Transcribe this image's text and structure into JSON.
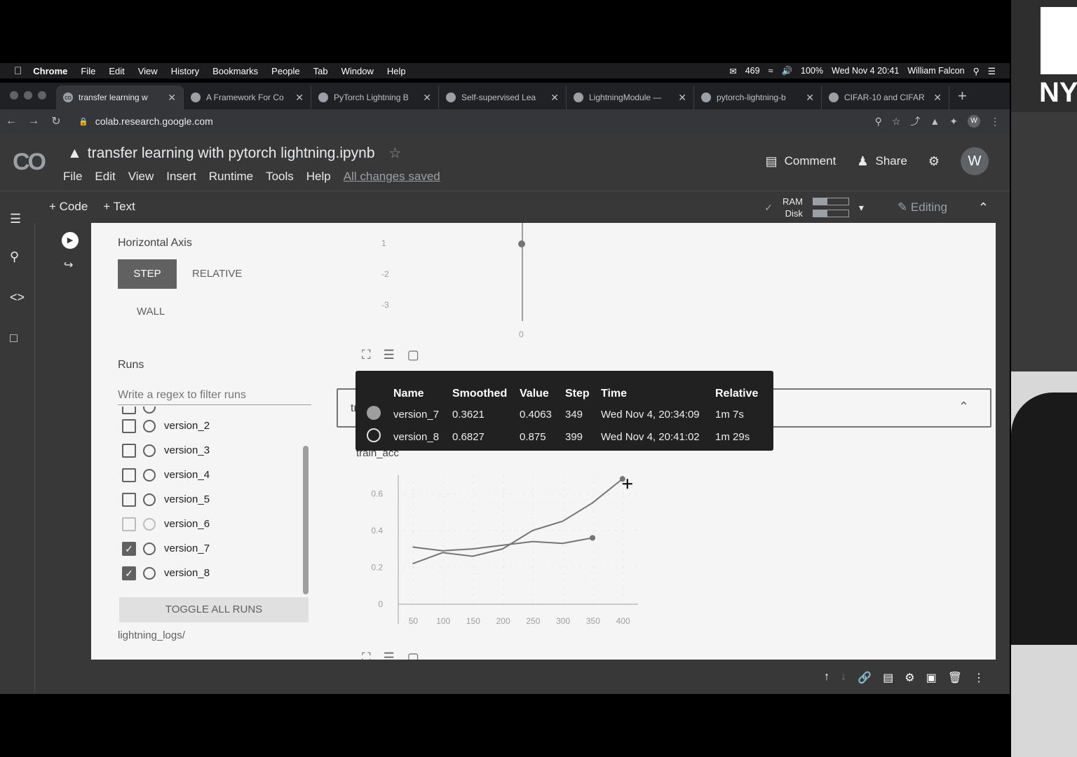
{
  "menubar": {
    "app": "Chrome",
    "items": [
      "File",
      "Edit",
      "View",
      "History",
      "Bookmarks",
      "People",
      "Tab",
      "Window",
      "Help"
    ],
    "mail_count": "469",
    "battery": "100%",
    "datetime": "Wed Nov 4  20:41",
    "user": "William Falcon"
  },
  "tabs": [
    {
      "title": "transfer learning w",
      "active": true
    },
    {
      "title": "A Framework For Co",
      "active": false
    },
    {
      "title": "PyTorch Lightning B",
      "active": false
    },
    {
      "title": "Self-supervised Lea",
      "active": false
    },
    {
      "title": "LightningModule —",
      "active": false
    },
    {
      "title": "pytorch-lightning-b",
      "active": false
    },
    {
      "title": "CIFAR-10 and CIFAR",
      "active": false
    }
  ],
  "address": {
    "url": "colab.research.google.com"
  },
  "colab": {
    "logo": "CO",
    "title": "transfer learning with pytorch lightning.ipynb",
    "menu": [
      "File",
      "Edit",
      "View",
      "Insert",
      "Runtime",
      "Tools",
      "Help"
    ],
    "saved": "All changes saved",
    "comment": "Comment",
    "share": "Share",
    "avatar": "W",
    "add_code": "+ Code",
    "add_text": "+ Text",
    "ram": "RAM",
    "disk": "Disk",
    "mode": "Editing"
  },
  "tensorboard": {
    "horizontal_axis_label": "Horizontal Axis",
    "axis_options": [
      "STEP",
      "RELATIVE",
      "WALL"
    ],
    "axis_selected": "STEP",
    "runs_label": "Runs",
    "filter_placeholder": "Write a regex to filter runs",
    "runs": [
      {
        "name": "version_2",
        "checked": false
      },
      {
        "name": "version_3",
        "checked": false
      },
      {
        "name": "version_4",
        "checked": false
      },
      {
        "name": "version_5",
        "checked": false
      },
      {
        "name": "version_6",
        "checked": false
      },
      {
        "name": "version_7",
        "checked": true
      },
      {
        "name": "version_8",
        "checked": true
      }
    ],
    "toggle_all": "TOGGLE ALL RUNS",
    "logdir": "lightning_logs/",
    "upper_ticks": [
      "1",
      "-2",
      "-3"
    ],
    "upper_x_tick": "0",
    "card_title": "train_acc"
  },
  "tooltip": {
    "headers": [
      "Name",
      "Smoothed",
      "Value",
      "Step",
      "Time",
      "Relative"
    ],
    "rows": [
      {
        "name": "version_7",
        "smoothed": "0.3621",
        "value": "0.4063",
        "step": "349",
        "time": "Wed Nov 4, 20:34:09",
        "relative": "1m 7s"
      },
      {
        "name": "version_8",
        "smoothed": "0.6827",
        "value": "0.875",
        "step": "399",
        "time": "Wed Nov 4, 20:41:02",
        "relative": "1m 29s"
      }
    ]
  },
  "chart_data": {
    "type": "line",
    "title": "train_acc",
    "xlabel": "",
    "ylabel": "",
    "x_ticks": [
      "50",
      "100",
      "150",
      "200",
      "250",
      "300",
      "350",
      "400"
    ],
    "y_ticks": [
      "0",
      "0.2",
      "0.4",
      "0.6"
    ],
    "xlim": [
      25,
      425
    ],
    "ylim": [
      0,
      0.7
    ],
    "grid": true,
    "series": [
      {
        "name": "version_7",
        "x": [
          49,
          99,
          149,
          199,
          249,
          299,
          349
        ],
        "y": [
          0.31,
          0.29,
          0.3,
          0.32,
          0.34,
          0.33,
          0.36
        ]
      },
      {
        "name": "version_8",
        "x": [
          49,
          99,
          149,
          199,
          249,
          299,
          349,
          399
        ],
        "y": [
          0.22,
          0.28,
          0.26,
          0.3,
          0.4,
          0.45,
          0.55,
          0.68
        ]
      }
    ],
    "colors": {
      "version_7": "#757575",
      "version_8": "#757575"
    }
  },
  "webcam": {
    "logo_text": "NY"
  }
}
